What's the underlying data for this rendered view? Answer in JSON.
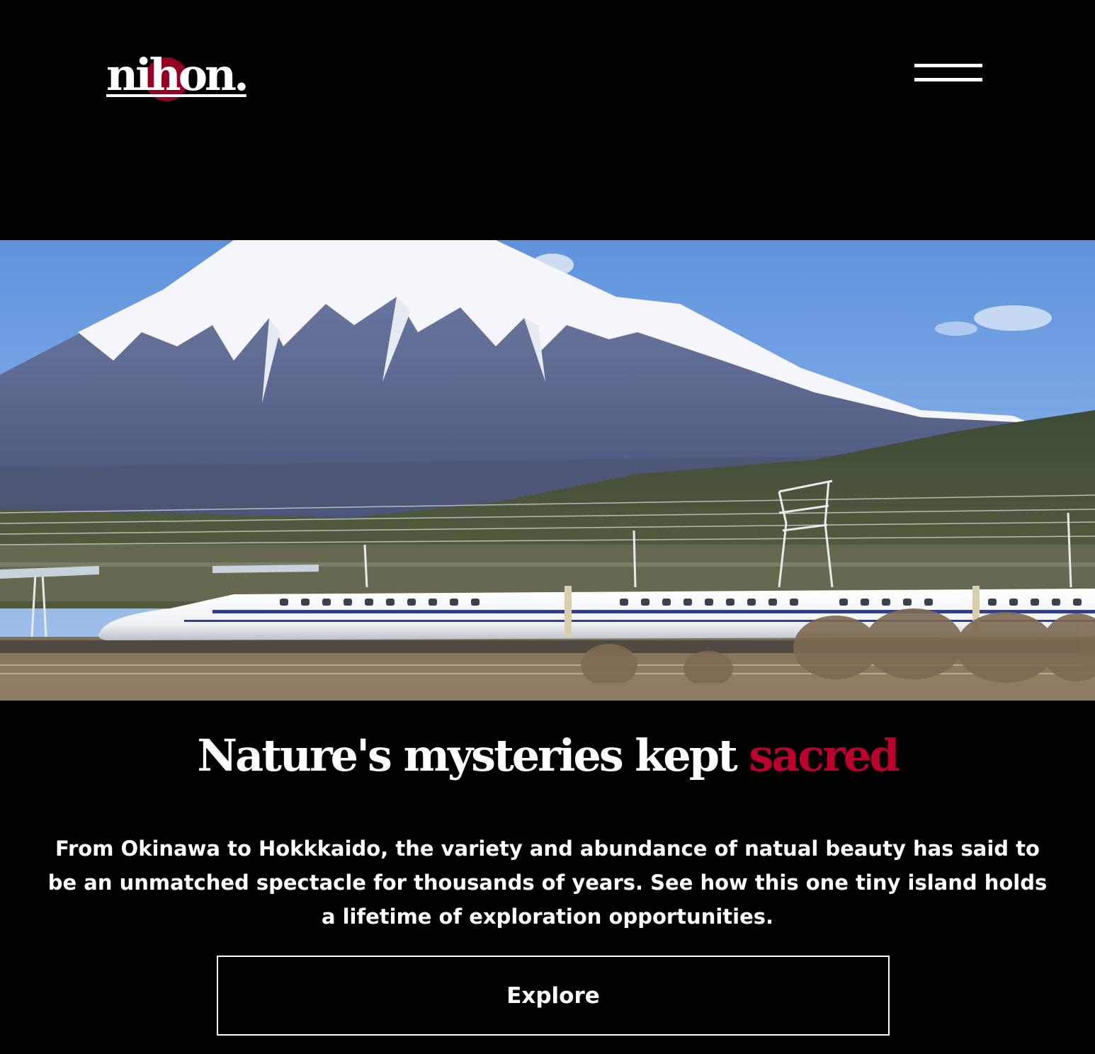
{
  "header": {
    "logo_text": "nihon.",
    "menu_icon": "hamburger-menu-icon"
  },
  "hero": {
    "image": "mount-fuji-bullet-train-photo"
  },
  "main": {
    "headline_prefix": "Nature's mysteries kept",
    "headline_accent": "sacred",
    "description": "From Okinawa to Hokkkaido, the variety and abundance of natual beauty has said to be an unmatched spectacle for thousands of years. See how this one tiny island holds a lifetime of exploration opportunities.",
    "cta_label": "Explore"
  },
  "colors": {
    "background": "#000000",
    "text": "#ffffff",
    "accent": "#bc002d"
  }
}
